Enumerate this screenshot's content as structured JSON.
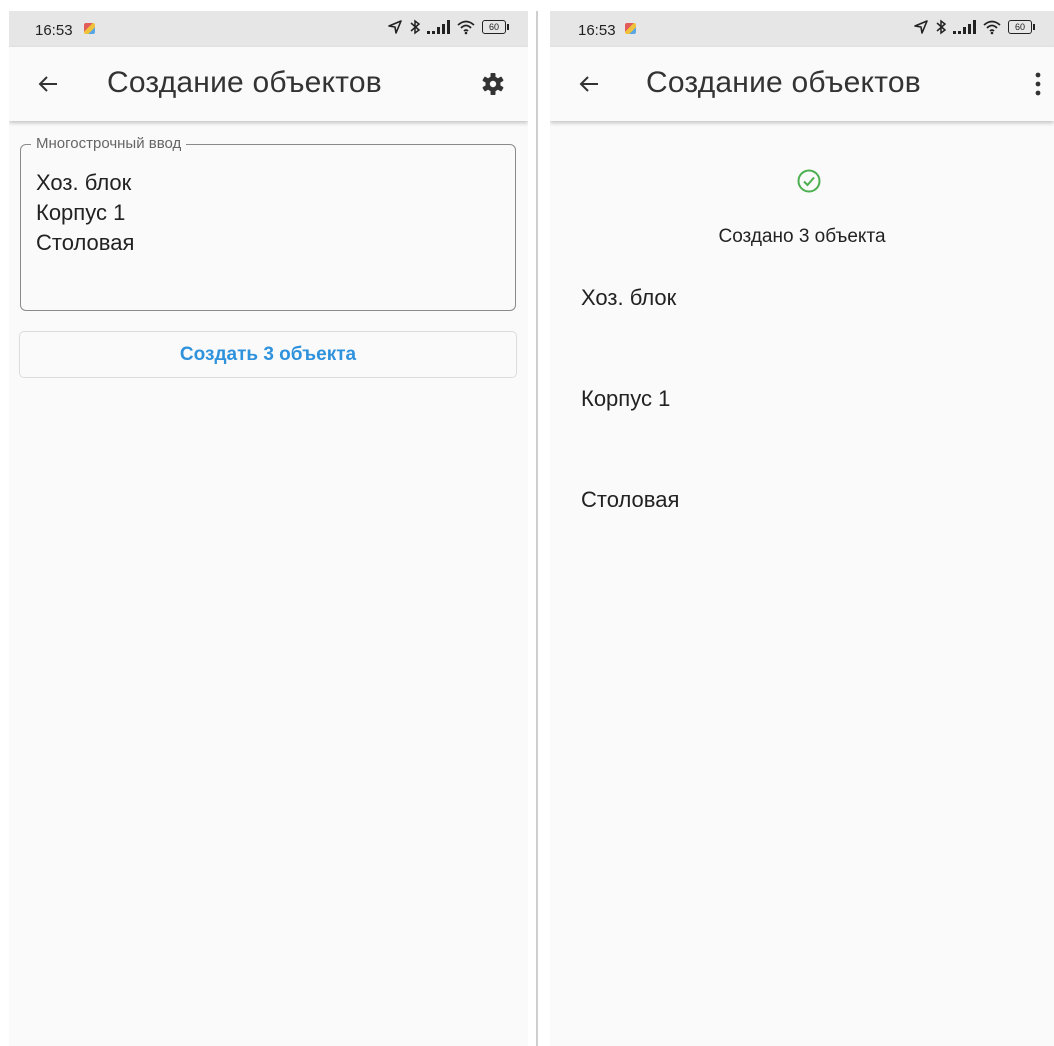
{
  "colors": {
    "accent": "#2f92dc",
    "success": "#4caf50",
    "background": "#fafafa",
    "statusbar": "#e6e6e6"
  },
  "left_screen": {
    "status_bar": {
      "time": "16:53",
      "battery": "60"
    },
    "app_bar": {
      "title": "Создание объектов",
      "back_icon": "arrow-left-icon",
      "action_icon": "gear-icon"
    },
    "input": {
      "legend": "Многострочный ввод",
      "lines": [
        "Хоз. блок",
        "Корпус 1",
        "Столовая"
      ]
    },
    "create_button": "Создать 3 объекта"
  },
  "right_screen": {
    "status_bar": {
      "time": "16:53",
      "battery": "60"
    },
    "app_bar": {
      "title": "Создание объектов",
      "back_icon": "arrow-left-icon",
      "action_icon": "more-vert-icon"
    },
    "success_icon": "check-circle-icon",
    "success_text": "Создано 3 объекта",
    "items": [
      "Хоз. блок",
      "Корпус 1",
      "Столовая"
    ]
  }
}
